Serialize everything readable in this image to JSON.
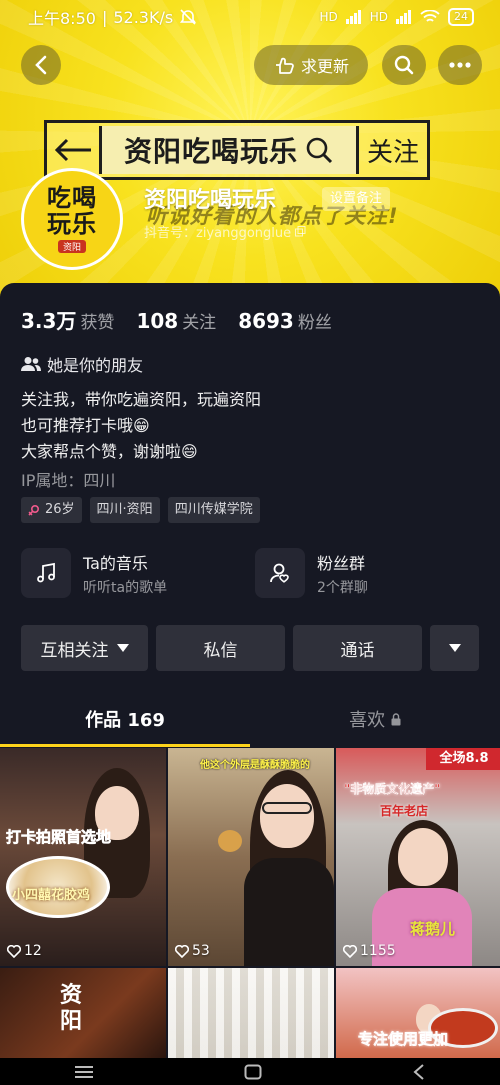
{
  "status_bar": {
    "time": "上午8:50",
    "speed": "52.3K/s",
    "signal1": "HD",
    "signal2": "HD",
    "battery": "24"
  },
  "header": {
    "update_label": "求更新"
  },
  "banner": {
    "title": "资阳吃喝玩乐",
    "follow": "关注",
    "tagline": "听说好看的人都点了关注!"
  },
  "avatar": {
    "line1": "吃喝",
    "line2": "玩乐",
    "city": "资阳"
  },
  "profile": {
    "name": "资阳吃喝玩乐",
    "remark_button": "设置备注",
    "douyin_id": "抖音号：ziyanggonglue"
  },
  "stats": [
    {
      "num": "3.3万",
      "label": "获赞"
    },
    {
      "num": "108",
      "label": "关注"
    },
    {
      "num": "8693",
      "label": "粉丝"
    }
  ],
  "friend_text": "她是你的朋友",
  "bio": {
    "line1": "关注我，带你吃遍资阳，玩遍资阳",
    "line2": "也可推荐打卡哦😁",
    "line3": "大家帮点个赞，谢谢啦😄"
  },
  "ip": "IP属地：四川",
  "tags": {
    "age": "26岁",
    "location": "四川·资阳",
    "school": "四川传媒学院"
  },
  "features": [
    {
      "title": "Ta的音乐",
      "subtitle": "听听ta的歌单",
      "icon": "music-note-icon"
    },
    {
      "title": "粉丝群",
      "subtitle": "2个群聊",
      "icon": "group-user-icon"
    }
  ],
  "actions": {
    "mutual": "互相关注",
    "message": "私信",
    "call": "通话"
  },
  "tabs": {
    "works": "作品 169",
    "likes": "喜欢"
  },
  "videos": [
    {
      "caption": "打卡拍照首选地",
      "caption2": "小四囍花胶鸡",
      "likes": "12"
    },
    {
      "caption": "他这个外层是酥酥脆脆的",
      "likes": "53"
    },
    {
      "caption": "\"非物质文化遗产\"",
      "caption2": "百年老店",
      "caption3": "蒋鹅儿",
      "banner": "全场8.8",
      "likes": "1155"
    },
    {
      "caption": "资阳"
    },
    {
      "caption": ""
    },
    {
      "caption": "专注使用更加"
    }
  ],
  "colors": {
    "accent_yellow": "#fdd31b",
    "panel_bg": "#161823",
    "button_bg": "#2f303a"
  }
}
